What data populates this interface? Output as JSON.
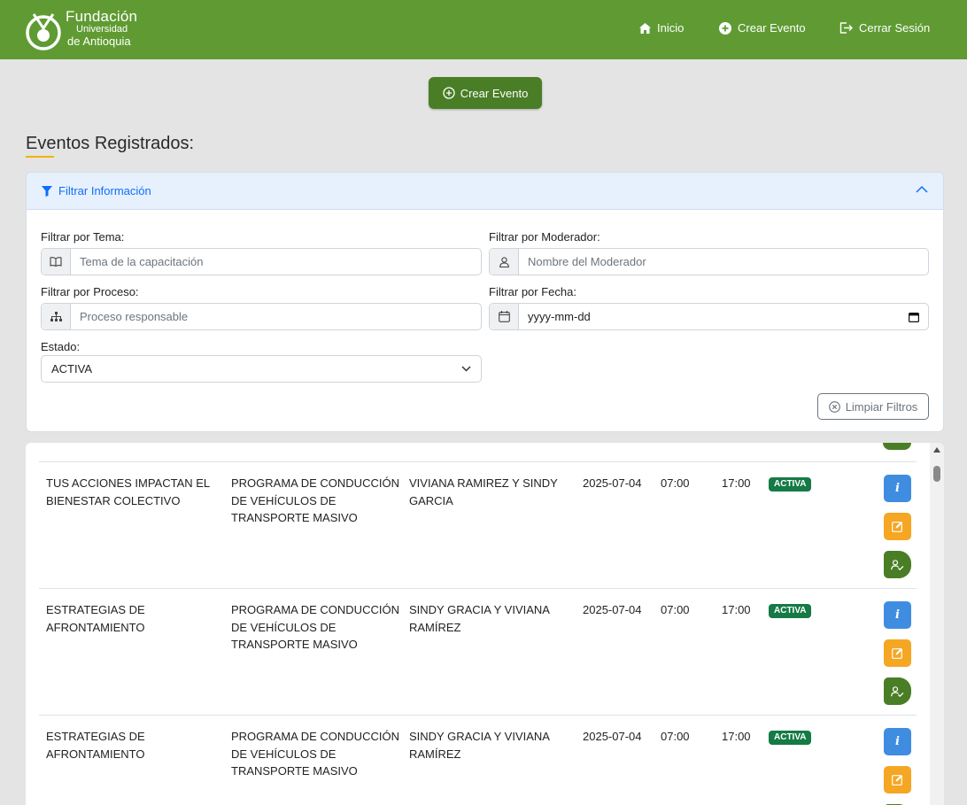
{
  "logo": {
    "line1": "Fundación",
    "line2": "Universidad",
    "line3": "de Antioquia"
  },
  "nav": {
    "inicio": "Inicio",
    "crear": "Crear Evento",
    "cerrar": "Cerrar Sesión"
  },
  "actions": {
    "crear_evento": "Crear Evento"
  },
  "page": {
    "title": "Eventos Registrados:"
  },
  "filter": {
    "header": "Filtrar Información",
    "tema_label": "Filtrar por Tema:",
    "tema_placeholder": "Tema de la capacitación",
    "moderador_label": "Filtrar por Moderador:",
    "moderador_placeholder": "Nombre del Moderador",
    "proceso_label": "Filtrar por Proceso:",
    "proceso_placeholder": "Proceso responsable",
    "fecha_label": "Filtrar por Fecha:",
    "fecha_value": "yyyy-mm-dd",
    "estado_label": "Estado:",
    "estado_value": "ACTIVA",
    "clear": "Limpiar Filtros"
  },
  "colors": {
    "primary_green": "#5f9b32",
    "dark_green": "#4a7e26",
    "info_blue": "#3f8de0",
    "edit_orange": "#f5a623",
    "accent_yellow": "#f0b400",
    "badge_green": "#157a45"
  },
  "events": [
    {
      "tema": "TUS ACCIONES IMPACTAN EL BIENESTAR COLECTIVO",
      "programa": "PROGRAMA DE CONDUCCIÓN DE VEHÍCULOS DE TRANSPORTE MASIVO",
      "moderador": "VIVIANA RAMIREZ Y SINDY GARCIA",
      "fecha": "2025-07-04",
      "hora_inicio": "07:00",
      "hora_fin": "17:00",
      "estado": "ACTIVA"
    },
    {
      "tema": "ESTRATEGIAS DE AFRONTAMIENTO",
      "programa": "PROGRAMA DE CONDUCCIÓN DE VEHÍCULOS DE TRANSPORTE MASIVO",
      "moderador": "SINDY GRACIA Y VIVIANA RAMÍREZ",
      "fecha": "2025-07-04",
      "hora_inicio": "07:00",
      "hora_fin": "17:00",
      "estado": "ACTIVA"
    },
    {
      "tema": "ESTRATEGIAS DE AFRONTAMIENTO",
      "programa": "PROGRAMA DE CONDUCCIÓN DE VEHÍCULOS DE TRANSPORTE MASIVO",
      "moderador": "SINDY GRACIA Y VIVIANA RAMÍREZ",
      "fecha": "2025-07-04",
      "hora_inicio": "07:00",
      "hora_fin": "17:00",
      "estado": "ACTIVA"
    }
  ],
  "icons": [
    "fundacion-logo-icon",
    "home-icon",
    "plus-circle-icon",
    "logout-icon",
    "filter-icon",
    "chevron-up-icon",
    "book-icon",
    "user-icon",
    "sitemap-icon",
    "calendar-icon",
    "chevron-down-icon",
    "x-circle-icon",
    "info-icon",
    "edit-icon",
    "user-check-icon"
  ]
}
